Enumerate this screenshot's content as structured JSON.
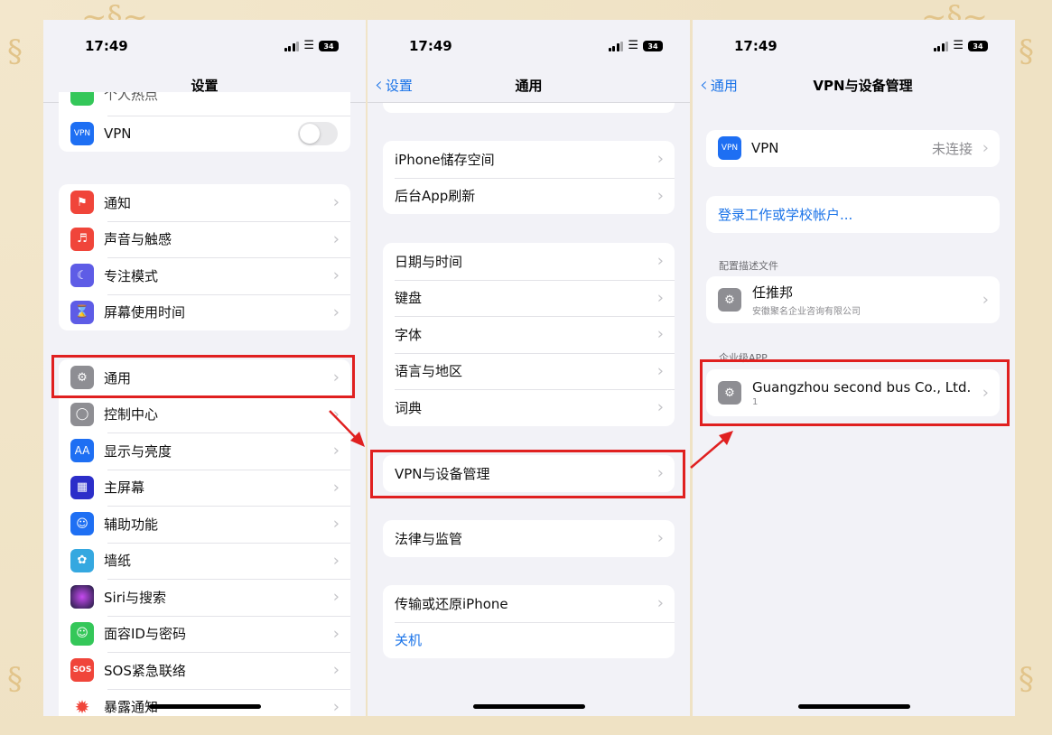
{
  "colors": {
    "accent": "#1a73e8",
    "highlight": "#e02020",
    "background": "#efe2c4"
  },
  "status": {
    "time": "17:49",
    "battery": "34"
  },
  "screen1": {
    "title": "设置",
    "partial_top_label": "个人热点",
    "vpn": {
      "label": "VPN",
      "icon_text": "VPN"
    },
    "group_a": [
      {
        "label": "通知",
        "icon": "bell-icon"
      },
      {
        "label": "声音与触感",
        "icon": "speaker-icon"
      },
      {
        "label": "专注模式",
        "icon": "moon-icon"
      },
      {
        "label": "屏幕使用时间",
        "icon": "hourglass-icon"
      }
    ],
    "group_b": [
      {
        "label": "通用",
        "icon": "gear-icon"
      },
      {
        "label": "控制中心",
        "icon": "toggles-icon"
      },
      {
        "label": "显示与亮度",
        "icon": "aa-icon",
        "icon_text": "AA"
      },
      {
        "label": "主屏幕",
        "icon": "grid-icon"
      },
      {
        "label": "辅助功能",
        "icon": "accessibility-icon"
      },
      {
        "label": "墙纸",
        "icon": "flower-icon"
      },
      {
        "label": "Siri与搜索",
        "icon": "siri-icon"
      },
      {
        "label": "面容ID与密码",
        "icon": "faceid-icon"
      },
      {
        "label": "SOS紧急联络",
        "icon": "sos-icon",
        "icon_text": "SOS"
      },
      {
        "label": "暴露通知",
        "icon": "exposure-icon"
      }
    ]
  },
  "screen2": {
    "back_label": "设置",
    "title": "通用",
    "group_a": [
      "iPhone储存空间",
      "后台App刷新"
    ],
    "group_b": [
      "日期与时间",
      "键盘",
      "字体",
      "语言与地区",
      "词典"
    ],
    "group_c": [
      "VPN与设备管理"
    ],
    "group_d": [
      "法律与监管"
    ],
    "group_e": [
      "传输或还原iPhone"
    ],
    "shutdown": "关机"
  },
  "screen3": {
    "back_label": "通用",
    "title": "VPN与设备管理",
    "vpn": {
      "label": "VPN",
      "icon_text": "VPN",
      "status": "未连接"
    },
    "login": "登录工作或学校帐户...",
    "profiles_header": "配置描述文件",
    "profile": {
      "name": "任推邦",
      "org": "安徽聚名企业咨询有限公司"
    },
    "enterprise_header": "企业级APP",
    "enterprise_app": {
      "name": "Guangzhou second bus Co., Ltd.",
      "count": "1"
    }
  }
}
